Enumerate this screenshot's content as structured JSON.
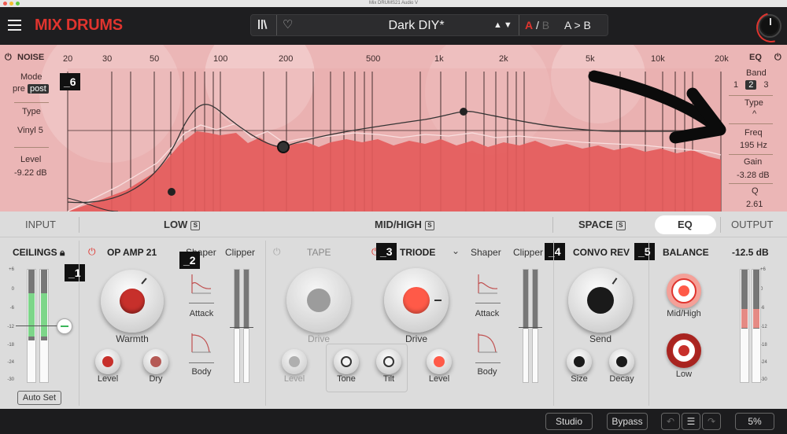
{
  "window": {
    "title": "Mix DRUMS21 Audio V"
  },
  "header": {
    "app_title": "MIX DRUMS",
    "preset_name": "Dark DIY*",
    "preset_arrows": "▲▼",
    "ab_a": "A",
    "ab_slash": "/",
    "ab_b": "B",
    "a_to_b": "A > B"
  },
  "noise": {
    "title": "NOISE",
    "mode_label": "Mode",
    "mode_options": [
      "pre",
      "post"
    ],
    "mode_selected": "post",
    "type_label": "Type",
    "type_value": "Vinyl 5",
    "level_label": "Level",
    "level_value": "-9.22 dB"
  },
  "eq_panel": {
    "title": "EQ",
    "band_label": "Band",
    "bands": [
      "1",
      "2",
      "3"
    ],
    "band_selected": "2",
    "type_label": "Type",
    "type_symbol": "^",
    "freq_label": "Freq",
    "freq_value": "195 Hz",
    "gain_label": "Gain",
    "gain_value": "-3.28 dB",
    "q_label": "Q",
    "q_value": "2.61"
  },
  "freq_axis": [
    "20",
    "30",
    "50",
    "100",
    "200",
    "500",
    "1k",
    "2k",
    "5k",
    "10k",
    "20k"
  ],
  "markers": {
    "m1": "_1",
    "m2": "_2",
    "m3": "_3",
    "m4": "_4",
    "m5": "_5",
    "m6": "_6"
  },
  "tabs": {
    "input": "INPUT",
    "low": "LOW",
    "midhigh": "MID/HIGH",
    "space": "SPACE",
    "eq": "EQ",
    "output": "OUTPUT",
    "solo": "S"
  },
  "ceilings": {
    "title": "CEILINGS",
    "scale": [
      "+6",
      "0",
      "-6",
      "-12",
      "-18",
      "-24",
      "-30"
    ],
    "auto_set": "Auto Set"
  },
  "opamp": {
    "title": "OP AMP 21",
    "warmth": "Warmth",
    "level": "Level",
    "dry": "Dry"
  },
  "shaper1": {
    "title": "Shaper",
    "attack": "Attack",
    "body": "Body"
  },
  "clipper1": {
    "title": "Clipper"
  },
  "tape": {
    "title": "TAPE",
    "drive": "Drive",
    "level": "Level"
  },
  "triode": {
    "title": "TRIODE",
    "drive": "Drive",
    "tone": "Tone",
    "tilt": "Tilt",
    "level": "Level"
  },
  "shaper2": {
    "title": "Shaper",
    "attack": "Attack",
    "body": "Body"
  },
  "clipper2": {
    "title": "Clipper"
  },
  "convo": {
    "title": "CONVO REV",
    "send": "Send",
    "size": "Size",
    "decay": "Decay"
  },
  "balance": {
    "title": "BALANCE",
    "midhigh": "Mid/High",
    "low": "Low"
  },
  "output": {
    "value": "-12.5 dB",
    "scale": [
      "+6",
      "0",
      "-6",
      "-12",
      "-18",
      "-24",
      "-30"
    ]
  },
  "bottom": {
    "studio": "Studio",
    "bypass": "Bypass",
    "zoom": "5%"
  },
  "colors": {
    "accent": "#e0342e",
    "header_bg": "#1e1e20",
    "viz_bg": "#ebb6b6",
    "spectrum": "#e45a5a"
  }
}
